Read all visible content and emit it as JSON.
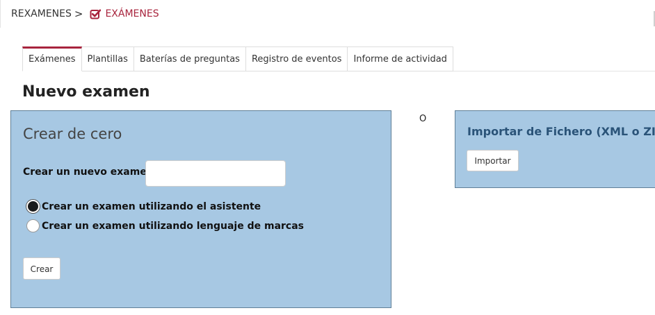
{
  "breadcrumb": {
    "root": "REXAMENES",
    "separator": ">",
    "current": "EXÁMENES",
    "current_icon": "checkbox-checked-icon",
    "accent_color": "#a8243d"
  },
  "tabs": [
    {
      "label": "Exámenes",
      "active": true
    },
    {
      "label": "Plantillas",
      "active": false
    },
    {
      "label": "Baterías de preguntas",
      "active": false
    },
    {
      "label": "Registro de eventos",
      "active": false
    },
    {
      "label": "Informe de actividad",
      "active": false
    }
  ],
  "page": {
    "title": "Nuevo examen"
  },
  "create_panel": {
    "heading": "Crear de cero",
    "name_label": "Crear un nuevo examen",
    "name_value": "",
    "options": [
      {
        "label": "Crear un examen utilizando el asistente",
        "checked": true
      },
      {
        "label": "Crear un examen utilizando lenguaje de marcas",
        "checked": false
      }
    ],
    "submit_label": "Crear",
    "background_color": "#a7c8e3"
  },
  "separator_text": "O",
  "import_panel": {
    "heading": "Importar de Fichero (XML o ZIP)",
    "button_label": "Importar"
  }
}
